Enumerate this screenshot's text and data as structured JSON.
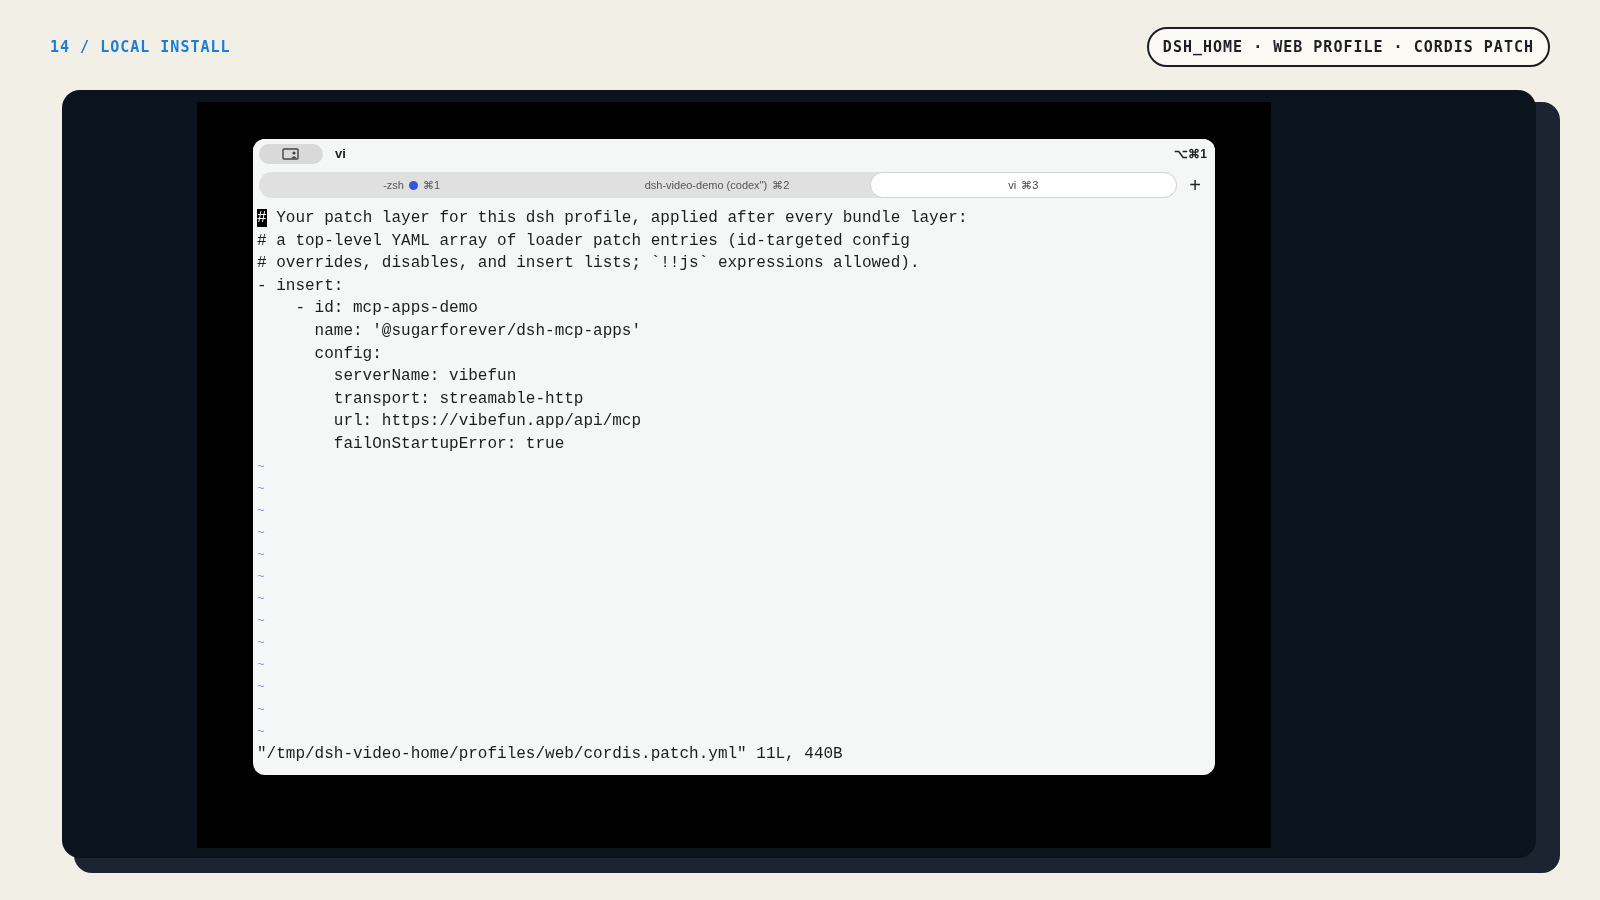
{
  "slide": {
    "section": "14 / LOCAL INSTALL",
    "badge": "DSH_HOME · WEB PROFILE · CORDIS PATCH"
  },
  "window": {
    "title": "vi",
    "shortcut": "⌥⌘1"
  },
  "tabs": [
    {
      "label": "-zsh",
      "shortcut": "⌘1",
      "activity": true,
      "selected": false
    },
    {
      "label": "dsh-video-demo (codex\")",
      "shortcut": "⌘2",
      "activity": false,
      "selected": false
    },
    {
      "label": "vi",
      "shortcut": "⌘3",
      "activity": false,
      "selected": true
    }
  ],
  "new_tab": "+",
  "editor": {
    "lines": [
      {
        "text": "# Your patch layer for this dsh profile, applied after every bundle layer:",
        "cursor": true
      },
      {
        "text": "# a top-level YAML array of loader patch entries (id-targeted config",
        "cursor": false
      },
      {
        "text": "# overrides, disables, and insert lists; `!!js` expressions allowed).",
        "cursor": false
      },
      {
        "text": "- insert:",
        "cursor": false
      },
      {
        "text": "    - id: mcp-apps-demo",
        "cursor": false
      },
      {
        "text": "      name: '@sugarforever/dsh-mcp-apps'",
        "cursor": false
      },
      {
        "text": "      config:",
        "cursor": false
      },
      {
        "text": "        serverName: vibefun",
        "cursor": false
      },
      {
        "text": "        transport: streamable-http",
        "cursor": false
      },
      {
        "text": "        url: https://vibefun.app/api/mcp",
        "cursor": false
      },
      {
        "text": "        failOnStartupError: true",
        "cursor": false
      }
    ],
    "empty_lines": [
      "~",
      "~",
      "~",
      "~",
      "~",
      "~",
      "~",
      "~",
      "~",
      "~",
      "~",
      "~",
      "~"
    ],
    "status": "\"/tmp/dsh-video-home/profiles/web/cordis.patch.yml\" 11L, 440B"
  }
}
